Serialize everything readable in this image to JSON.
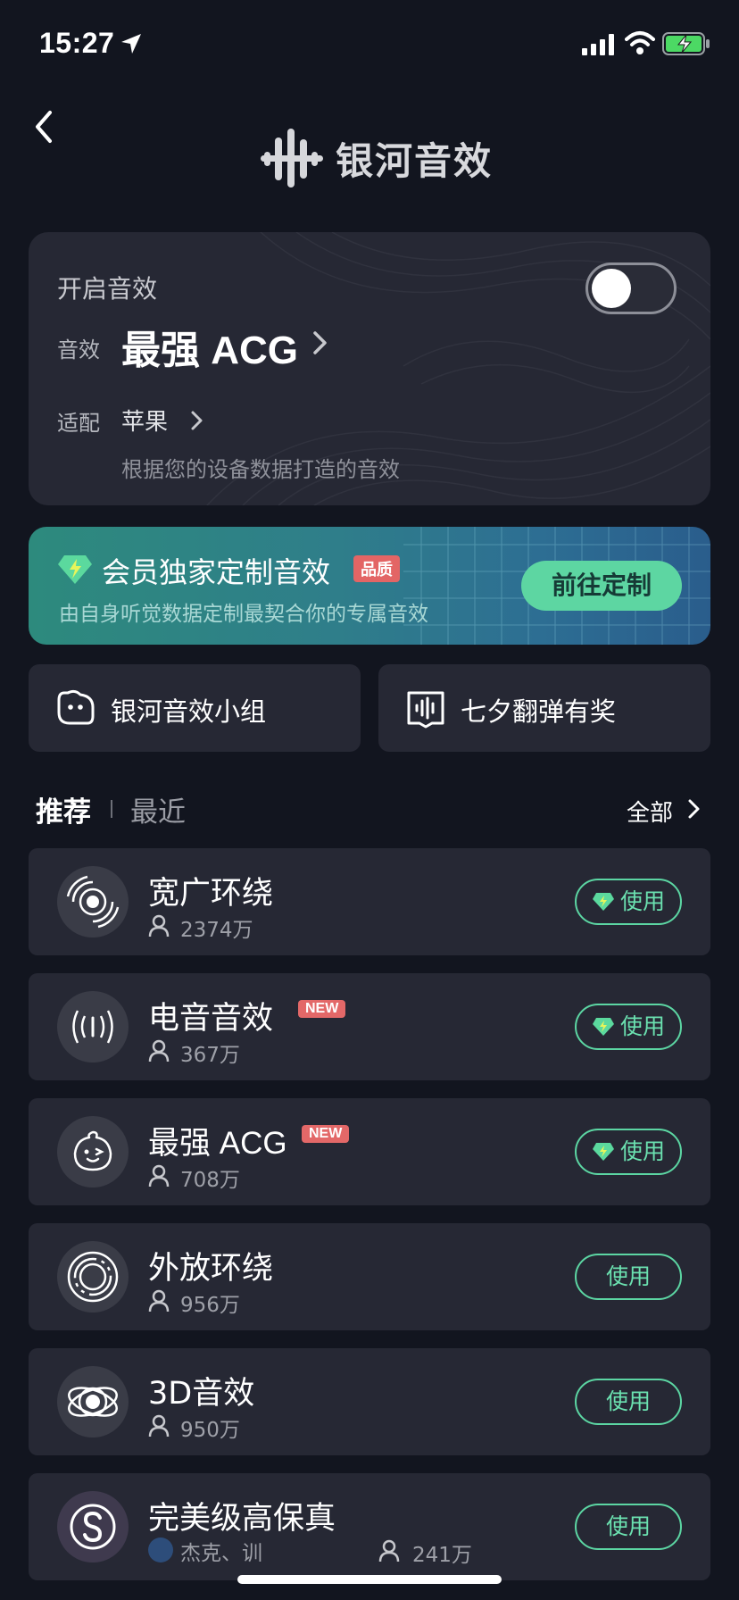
{
  "status_bar": {
    "time": "15:27"
  },
  "header": {
    "logo_text": "银河音效"
  },
  "fx_card": {
    "enable_label": "开启音效",
    "toggle_on": false,
    "effect_label": "音效",
    "effect_value": "最强 ACG",
    "adapt_label": "适配",
    "adapt_value": "苹果",
    "description": "根据您的设备数据打造的音效"
  },
  "vip_banner": {
    "title": "会员独家定制音效",
    "badge": "品质",
    "subtitle": "由自身听觉数据定制最契合你的专属音效",
    "button": "前往定制"
  },
  "entries": [
    {
      "label": "银河音效小组",
      "icon": "chat-bubble-icon"
    },
    {
      "label": "七夕翻弹有奖",
      "icon": "waveform-icon"
    }
  ],
  "tabs": {
    "recommend": "推荐",
    "recent": "最近",
    "see_all": "全部"
  },
  "list": [
    {
      "name": "宽广环绕",
      "count": "2374万",
      "vip": true,
      "new": false,
      "icon": "surround-icon",
      "button": "使用"
    },
    {
      "name": "电音音效",
      "count": "367万",
      "vip": true,
      "new": true,
      "new_label": "NEW",
      "icon": "electronic-icon",
      "button": "使用"
    },
    {
      "name": "最强 ACG",
      "count": "708万",
      "vip": true,
      "new": true,
      "new_label": "NEW",
      "icon": "acg-face-icon",
      "button": "使用"
    },
    {
      "name": "外放环绕",
      "count": "956万",
      "vip": false,
      "new": false,
      "icon": "speaker-surround-icon",
      "button": "使用"
    },
    {
      "name": "3D音效",
      "count": "950万",
      "vip": false,
      "new": false,
      "icon": "orbit-3d-icon",
      "button": "使用"
    },
    {
      "name": "完美级高保真",
      "author": "杰克、训",
      "count": "241万",
      "vip": false,
      "new": false,
      "icon": "hifi-s-icon",
      "button": "使用"
    }
  ],
  "colors": {
    "accent": "#5cd6a3",
    "background": "#12151f",
    "card": "#262834",
    "badge": "#e36868"
  }
}
